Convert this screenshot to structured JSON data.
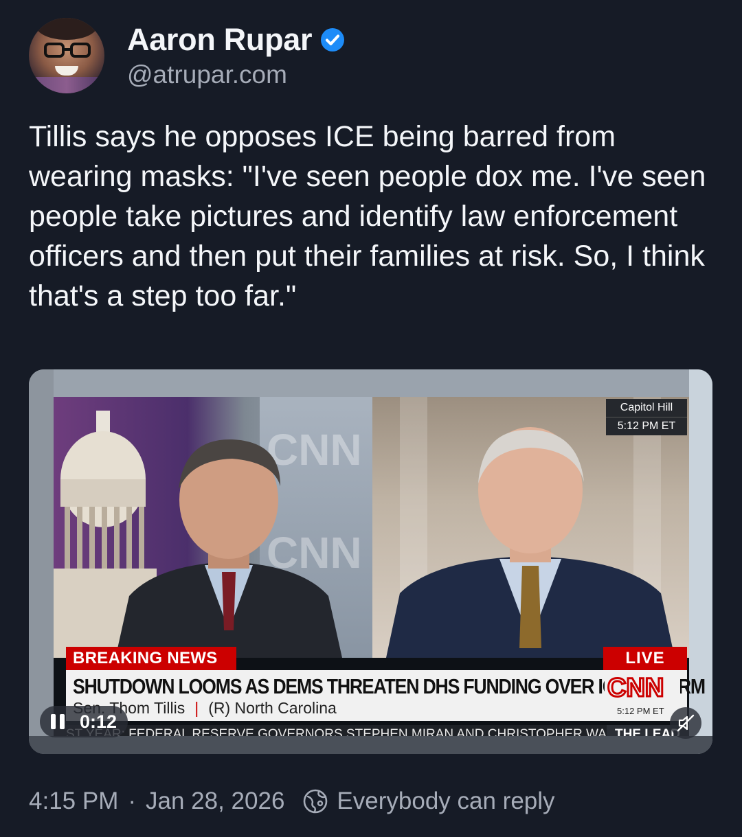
{
  "author": {
    "name": "Aaron Rupar",
    "handle": "@atrupar.com",
    "verified": true
  },
  "post": {
    "text": "Tillis says he opposes ICE being barred from wearing masks: \"I've seen people dox me. I've seen people take pictures and identify law enforcement officers and then put their families at risk. So, I think that's a step too far.\""
  },
  "video": {
    "location": "Capitol Hill",
    "location_time": "5:12 PM ET",
    "breaking_label": "BREAKING NEWS",
    "live_label": "LIVE",
    "headline": "SHUTDOWN LOOMS AS DEMS THREATEN DHS FUNDING OVER ICE REFORM",
    "guest_name": "Sen. Thom Tillis",
    "guest_detail": "(R) North Carolina",
    "network_logo": "CNN",
    "lower_third_time": "5:12 PM ET",
    "ticker": "ST YEAR: FEDERAL RESERVE GOVERNORS STEPHEN MIRAN AND CHRISTOPHER WALLE",
    "ticker_tag": "THE LEAD",
    "playback_time": "0:12",
    "state": "playing",
    "muted": true
  },
  "footer": {
    "time": "4:15 PM",
    "date": "Jan 28, 2026",
    "reply_setting": "Everybody can reply"
  },
  "colors": {
    "background": "#161b26",
    "verified_blue": "#1d8cf8",
    "cnn_red": "#cc0000",
    "muted_text": "#a6acb8"
  },
  "icons": [
    "verified-badge-icon",
    "pause-icon",
    "mute-icon",
    "globe-icon"
  ]
}
